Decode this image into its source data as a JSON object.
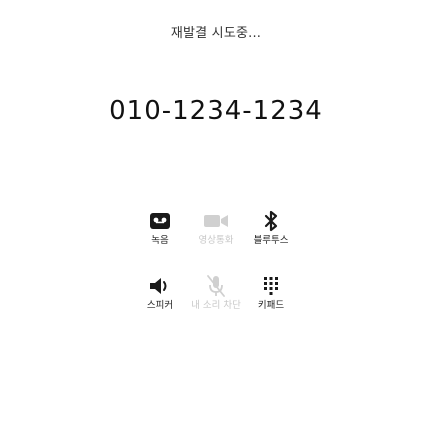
{
  "call": {
    "status": "재발결 시도중...",
    "number": "010-1234-1234"
  },
  "buttons": {
    "record": {
      "label": "녹음",
      "icon": "record-icon",
      "enabled": true
    },
    "video": {
      "label": "영상통화",
      "icon": "video-camera-icon",
      "enabled": false
    },
    "bluetooth": {
      "label": "블루투스",
      "icon": "bluetooth-icon",
      "enabled": true
    },
    "speaker": {
      "label": "스피커",
      "icon": "speaker-icon",
      "enabled": true
    },
    "mute": {
      "label": "내 소리 차단",
      "icon": "mic-off-icon",
      "enabled": false
    },
    "keypad": {
      "label": "키패드",
      "icon": "keypad-icon",
      "enabled": true
    }
  },
  "colors": {
    "active": "#1a1a1a",
    "disabled": "#c8c8c8",
    "background": "#ffffff"
  }
}
